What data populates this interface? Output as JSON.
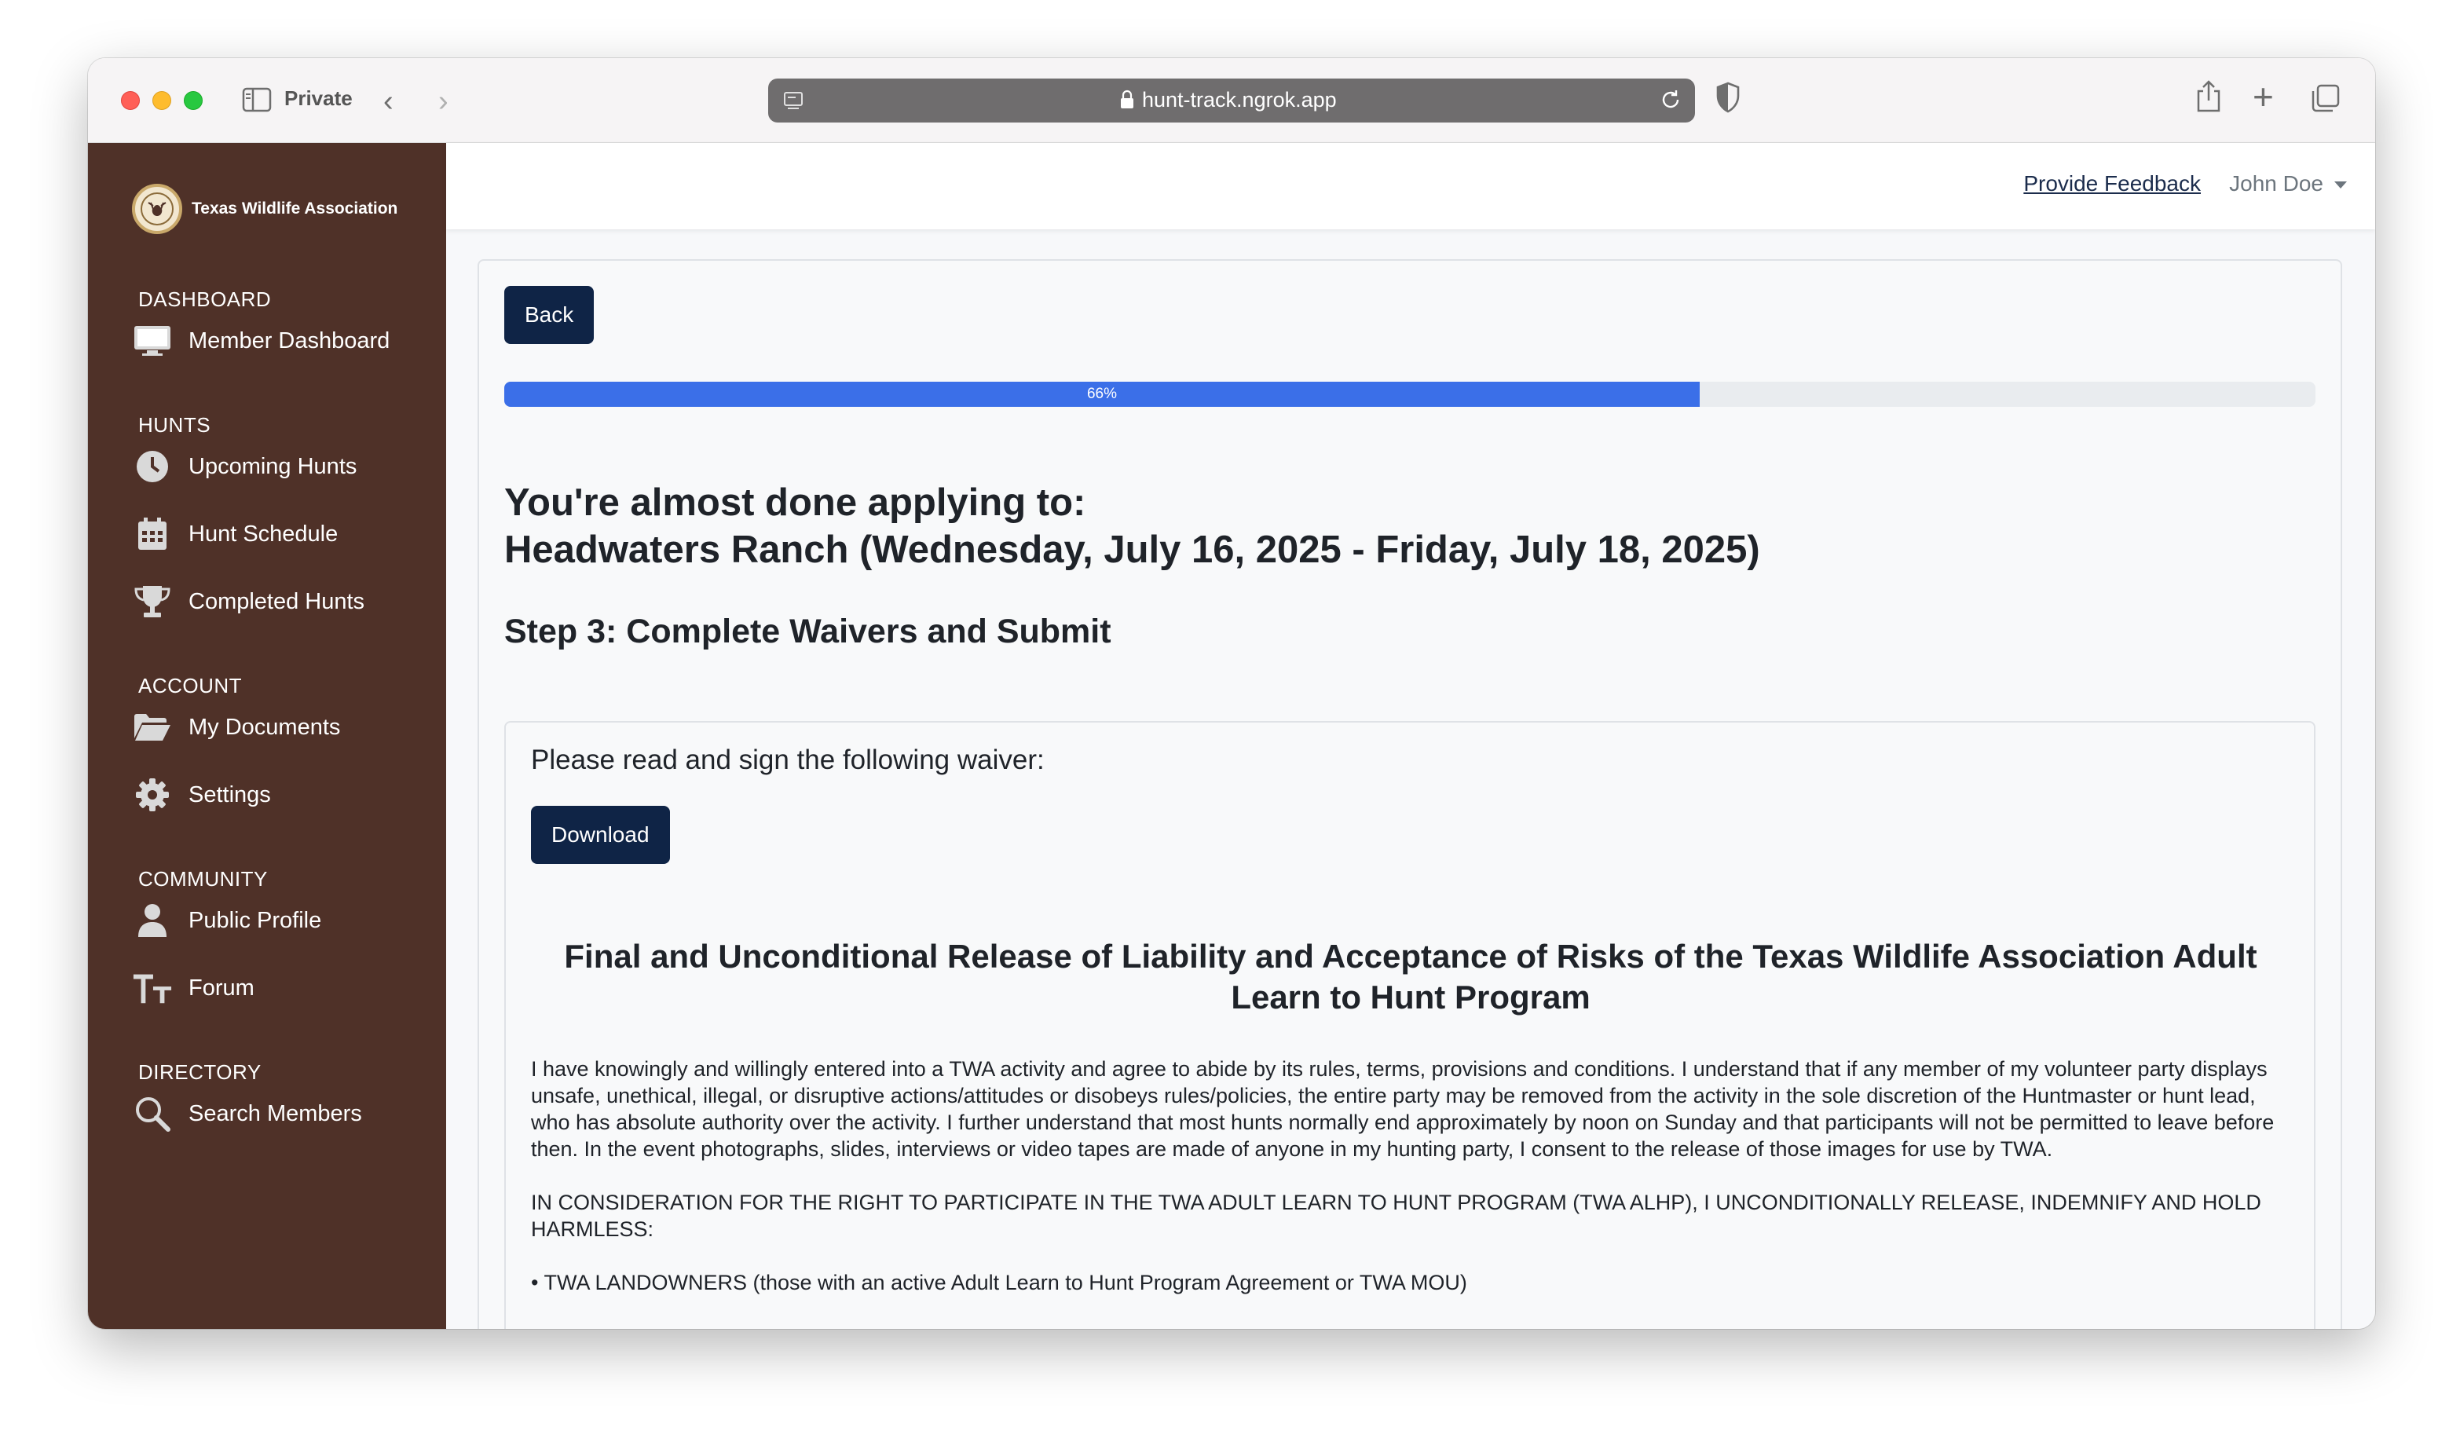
{
  "browser": {
    "private_label": "Private",
    "url": "hunt-track.ngrok.app"
  },
  "sidebar": {
    "brand": "Texas Wildlife Association",
    "sections": {
      "dashboard": "DASHBOARD",
      "hunts": "HUNTS",
      "account": "ACCOUNT",
      "community": "COMMUNITY",
      "directory": "DIRECTORY"
    },
    "items": {
      "member_dashboard": "Member Dashboard",
      "upcoming_hunts": "Upcoming Hunts",
      "hunt_schedule": "Hunt Schedule",
      "completed_hunts": "Completed Hunts",
      "my_documents": "My Documents",
      "settings": "Settings",
      "public_profile": "Public Profile",
      "forum": "Forum",
      "search_members": "Search Members"
    },
    "colors": {
      "background": "#4f3128"
    }
  },
  "topbar": {
    "feedback": "Provide Feedback",
    "user": "John Doe"
  },
  "main": {
    "back_label": "Back",
    "progress": {
      "percent": 66,
      "label": "66%"
    },
    "headline_line1": "You're almost done applying to:",
    "headline_line2": "Headwaters Ranch (Wednesday, July 16, 2025 - Friday, July 18, 2025)",
    "step": "Step 3: Complete Waivers and Submit",
    "waiver": {
      "prompt": "Please read and sign the following waiver:",
      "download_label": "Download",
      "title": "Final and Unconditional Release of Liability and Acceptance of Risks of the Texas Wildlife Association Adult Learn to Hunt Program",
      "paragraph1": "I have knowingly and willingly entered into a TWA activity and agree to abide by its rules, terms, provisions and conditions. I understand that if any member of my volunteer party displays unsafe, unethical, illegal, or disruptive actions/attitudes or disobeys rules/policies, the entire party may be removed from the activity in the sole discretion of the Huntmaster or hunt lead, who has absolute authority over the activity. I further understand that most hunts normally end approximately by noon on Sunday and that participants will not be permitted to leave before then. In the event photographs, slides, interviews or video tapes are made of anyone in my hunting party, I consent to the release of those images for use by TWA.",
      "paragraph2": "IN CONSIDERATION FOR THE RIGHT TO PARTICIPATE IN THE TWA ADULT LEARN TO HUNT PROGRAM (TWA ALHP), I UNCONDITIONALLY RELEASE, INDEMNIFY AND HOLD HARMLESS:",
      "bullet1": "• TWA LANDOWNERS (those with an active Adult Learn to Hunt Program Agreement or TWA MOU)"
    }
  },
  "colors": {
    "primary_button": "#0f2446",
    "progress_fill": "#3b6fe8"
  }
}
